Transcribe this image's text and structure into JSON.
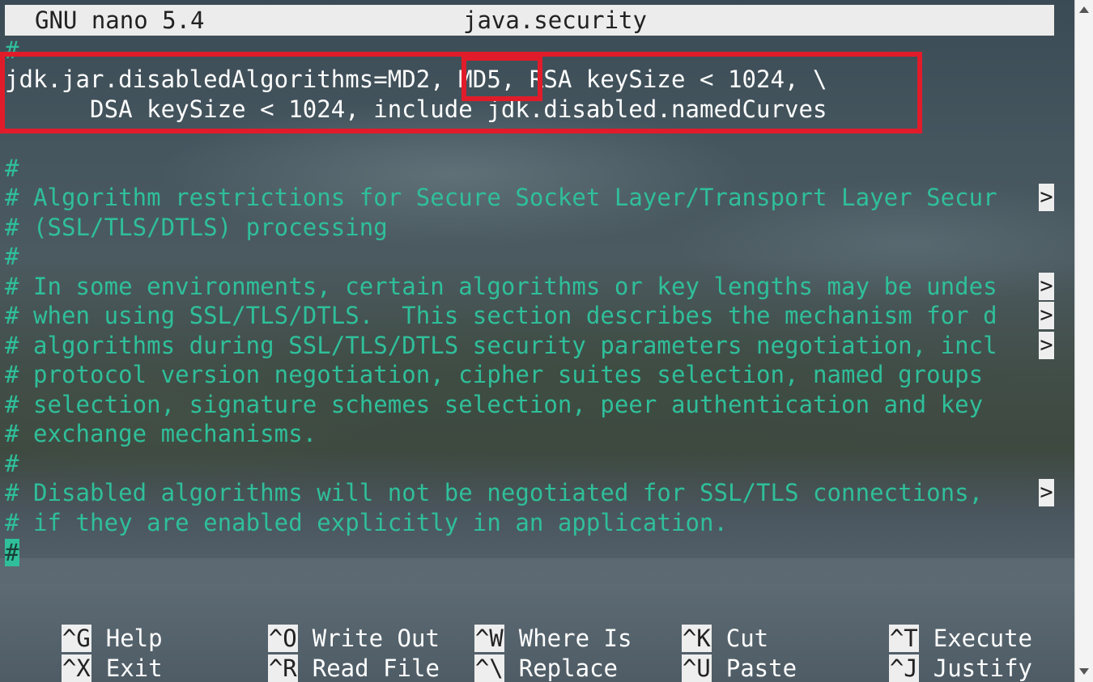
{
  "titlebar": {
    "app": "GNU nano 5.4",
    "filename": "java.security"
  },
  "editor": {
    "lines": [
      "#",
      "jdk.jar.disabledAlgorithms=MD2, MD5, RSA keySize < 1024, \\",
      "      DSA keySize < 1024, include jdk.disabled.namedCurves",
      "",
      "#",
      "# Algorithm restrictions for Secure Socket Layer/Transport Layer Secur",
      "# (SSL/TLS/DTLS) processing",
      "#",
      "# In some environments, certain algorithms or key lengths may be undes",
      "# when using SSL/TLS/DTLS.  This section describes the mechanism for d",
      "# algorithms during SSL/TLS/DTLS security parameters negotiation, incl",
      "# protocol version negotiation, cipher suites selection, named groups",
      "# selection, signature schemes selection, peer authentication and key",
      "# exchange mechanisms.",
      "#",
      "# Disabled algorithms will not be negotiated for SSL/TLS connections, ",
      "# if they are enabled explicitly in an application."
    ],
    "cursor_char": "#",
    "overflow_marker": ">"
  },
  "shortcuts": [
    {
      "key": "^G",
      "label": "Help"
    },
    {
      "key": "^O",
      "label": "Write Out"
    },
    {
      "key": "^W",
      "label": "Where Is"
    },
    {
      "key": "^K",
      "label": "Cut"
    },
    {
      "key": "^T",
      "label": "Execute"
    },
    {
      "key": "^X",
      "label": "Exit"
    },
    {
      "key": "^R",
      "label": "Read File"
    },
    {
      "key": "^\\",
      "label": "Replace"
    },
    {
      "key": "^U",
      "label": "Paste"
    },
    {
      "key": "^J",
      "label": "Justify"
    }
  ],
  "colors": {
    "comment": "#2fbf9a",
    "config_text": "#ffffff",
    "highlight_box": "#e11c2a",
    "titlebar_bg": "#ececec"
  }
}
